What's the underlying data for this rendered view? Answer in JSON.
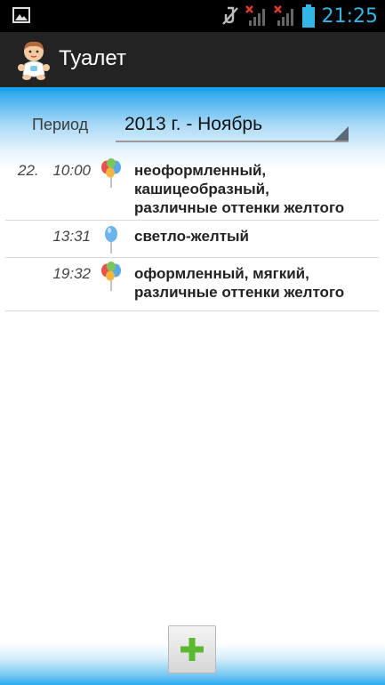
{
  "status_bar": {
    "time": "21:25",
    "icons": [
      "gallery-icon",
      "mute-icon",
      "signal-no-service-icon",
      "signal-no-service-icon",
      "battery-icon"
    ]
  },
  "action_bar": {
    "title": "Туалет",
    "icon": "baby-icon"
  },
  "period": {
    "label": "Период",
    "value": "2013 г. - Ноябрь"
  },
  "entries": [
    {
      "date": "22.",
      "time": "10:00",
      "icon": "balloons-multicolor-icon",
      "description": "неоформленный,\nкашицеобразный,\nразличные оттенки желтого"
    },
    {
      "date": "",
      "time": "13:31",
      "icon": "balloon-blue-icon",
      "description": "светло-желтый"
    },
    {
      "date": "",
      "time": "19:32",
      "icon": "balloons-multicolor-icon",
      "description": "оформленный, мягкий,\nразличные оттенки желтого"
    }
  ],
  "bottom": {
    "add_icon": "plus-icon"
  },
  "colors": {
    "accent": "#33b5e5",
    "action_bar": "#232323",
    "plus": "#5cb82e"
  }
}
